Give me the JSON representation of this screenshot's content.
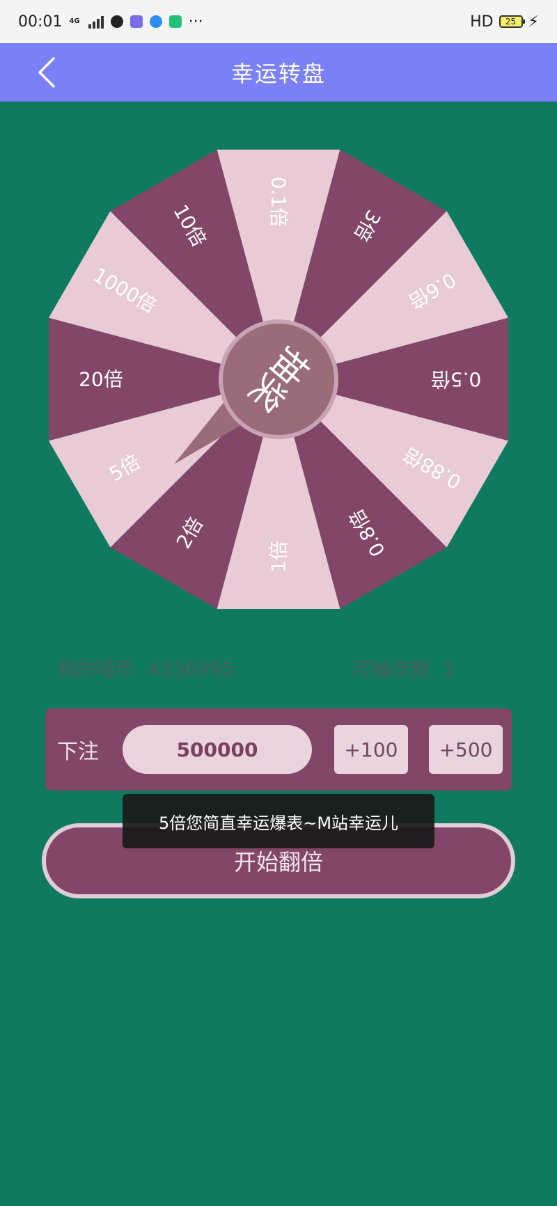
{
  "status_bar": {
    "time": "00:01",
    "network": "4G",
    "more": "···",
    "hd": "HD",
    "battery": "25"
  },
  "nav": {
    "title": "幸运转盘"
  },
  "wheel": {
    "center_label": "抽奖",
    "segments": [
      "0.1倍",
      "3倍",
      "0.6倍",
      "0.5倍",
      "0.88倍",
      "0.8倍",
      "1倍",
      "2倍",
      "5倍",
      "20倍",
      "1000倍",
      "10倍"
    ],
    "colors": {
      "light": "#e8cbd4",
      "dark": "#824668",
      "hub": "#9a6b78",
      "hub_ring": "#c7a3b3"
    }
  },
  "info": {
    "coins_label": "我的喵币",
    "coins_value": "4336995",
    "draws_label": "可抽次数",
    "draws_value": "1"
  },
  "bet": {
    "label": "下注",
    "amount": "500000",
    "plus100": "+100",
    "plus500": "+500"
  },
  "start_button": "开始翻倍",
  "toast": "5倍您简直幸运爆表~M站幸运儿"
}
